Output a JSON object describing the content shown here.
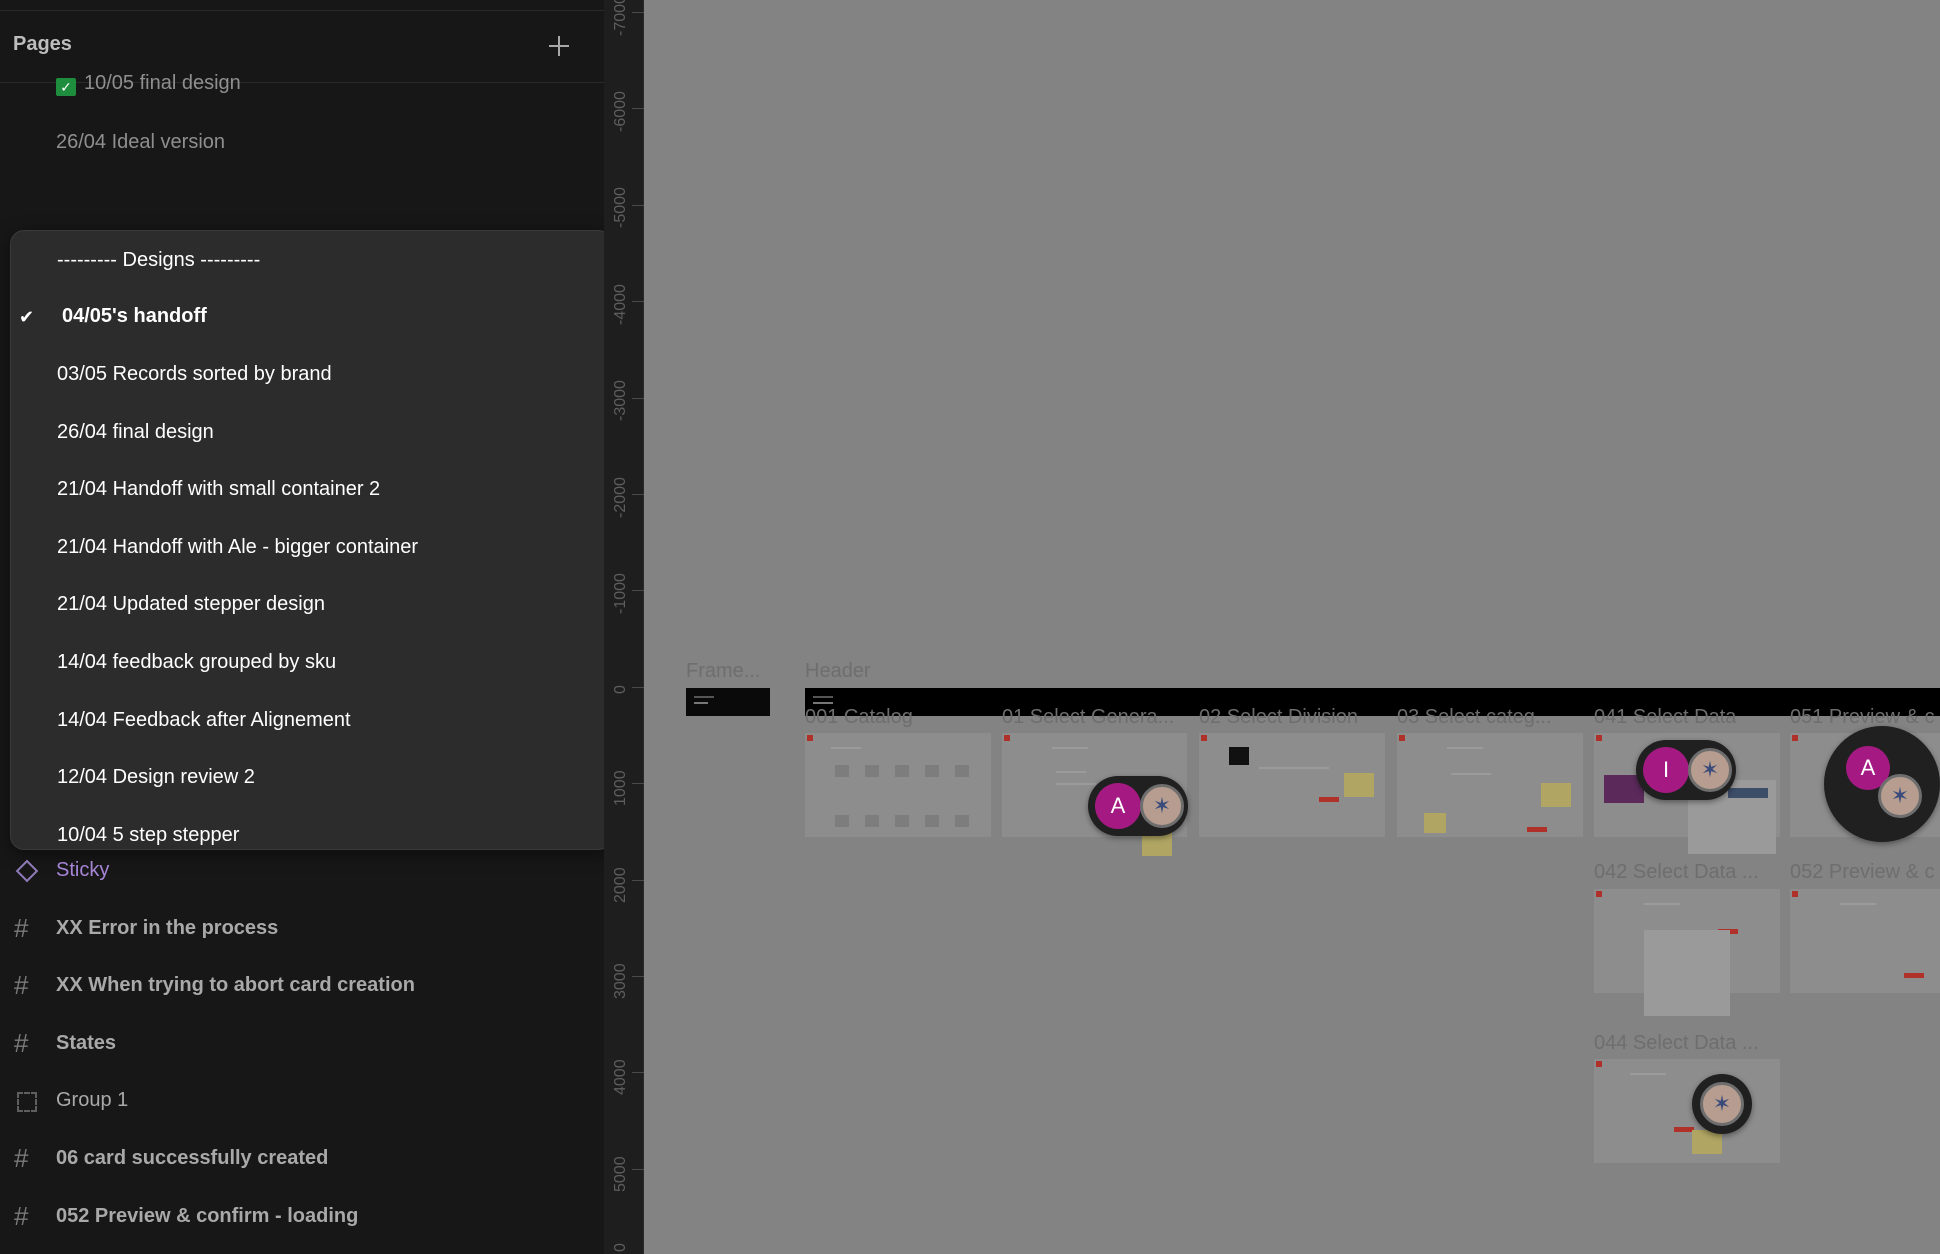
{
  "pages_panel": {
    "title": "Pages",
    "add_label": "+",
    "above_items": [
      {
        "label": "10/05 final design"
      },
      {
        "label": "26/04 Ideal version"
      }
    ]
  },
  "dropdown": {
    "items": [
      {
        "label": "--------- Designs ---------",
        "selected": false
      },
      {
        "label": "04/05's handoff",
        "selected": true
      },
      {
        "label": "03/05 Records sorted by brand",
        "selected": false
      },
      {
        "label": "26/04 final design",
        "selected": false
      },
      {
        "label": "21/04 Handoff with small container 2",
        "selected": false
      },
      {
        "label": "21/04 Handoff with Ale - bigger container",
        "selected": false
      },
      {
        "label": "21/04 Updated stepper design",
        "selected": false
      },
      {
        "label": "14/04 feedback grouped by sku",
        "selected": false
      },
      {
        "label": "14/04 Feedback after Alignement",
        "selected": false
      },
      {
        "label": "12/04 Design review 2",
        "selected": false
      },
      {
        "label": "10/04 5 step stepper",
        "selected": false
      }
    ],
    "check_icon": "check-icon"
  },
  "layers": [
    {
      "label": "Sticky",
      "icon": "component-icon"
    },
    {
      "label": "XX Error in the process",
      "icon": "frame-icon"
    },
    {
      "label": "XX When trying to abort card creation",
      "icon": "frame-icon"
    },
    {
      "label": "States",
      "icon": "frame-icon"
    },
    {
      "label": "Group 1",
      "icon": "group-icon"
    },
    {
      "label": "06 card successfully created",
      "icon": "frame-icon"
    },
    {
      "label": "052 Preview & confirm - loading",
      "icon": "frame-icon"
    }
  ],
  "ruler": {
    "labels": [
      "-7000",
      "-6000",
      "-5000",
      "-4000",
      "-3000",
      "-2000",
      "-1000",
      "0",
      "1000",
      "2000",
      "3000",
      "4000",
      "5000",
      "0"
    ]
  },
  "canvas": {
    "frames": [
      {
        "label": "Frame..."
      },
      {
        "label": "Header"
      },
      {
        "label": "001 Catalog"
      },
      {
        "label": "01 Select Genera..."
      },
      {
        "label": "02 Select Division"
      },
      {
        "label": "03 Select categ..."
      },
      {
        "label": "041 Select Data"
      },
      {
        "label": "051 Preview & c"
      },
      {
        "label": "042 Select Data ..."
      },
      {
        "label": "052 Preview & c"
      },
      {
        "label": "044 Select Data ..."
      }
    ],
    "avatars": [
      {
        "letter": "A"
      },
      {
        "letter": "I"
      },
      {
        "letter": "A"
      }
    ]
  },
  "colors": {
    "panel_bg": "#171717",
    "dropdown_bg": "#2c2c2c",
    "canvas_bg": "#828382",
    "avatar_magenta": "#a51a82",
    "check_green": "#1e8e3e",
    "accent_red": "#b0302a"
  }
}
